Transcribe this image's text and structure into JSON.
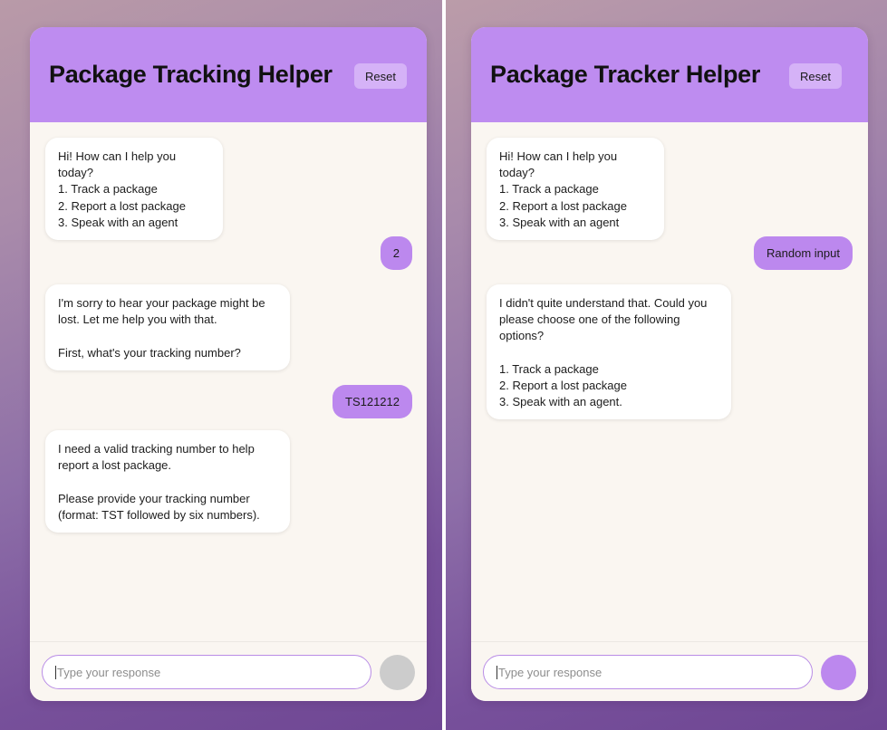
{
  "left": {
    "title": "Package Tracking Helper",
    "reset_label": "Reset",
    "messages": [
      {
        "role": "bot",
        "text": "Hi! How can I help you today?\n1. Track a package\n2. Report a lost package\n3. Speak with an agent"
      },
      {
        "role": "user",
        "text": "2"
      },
      {
        "role": "bot",
        "text": "I'm sorry to hear your package might be lost. Let me help you with that.\n\nFirst, what's your tracking number?"
      },
      {
        "role": "user",
        "text": "TS121212"
      },
      {
        "role": "bot",
        "text": "I need a valid tracking number to help report a lost package.\n\nPlease provide your tracking number (format: TST followed by six numbers)."
      }
    ],
    "input": {
      "placeholder": "Type your response",
      "value": ""
    },
    "send_button_color": "#cccccc"
  },
  "right": {
    "title": "Package Tracker Helper",
    "reset_label": "Reset",
    "messages": [
      {
        "role": "bot",
        "text": "Hi! How can I help you today?\n1. Track a package\n2. Report a lost package\n3. Speak with an agent"
      },
      {
        "role": "user",
        "text": "Random input"
      },
      {
        "role": "bot",
        "text": "I didn't quite understand that. Could you please choose one of the following options?\n\n1. Track a package\n2. Report a lost package\n3. Speak with an agent."
      }
    ],
    "input": {
      "placeholder": "Type your response",
      "value": ""
    },
    "send_button_color": "#bc88ee"
  },
  "colors": {
    "header": "#be8cf0",
    "user_bubble": "#bc88ee",
    "chat_background": "#faf6f1",
    "bot_bubble": "#ffffff"
  }
}
